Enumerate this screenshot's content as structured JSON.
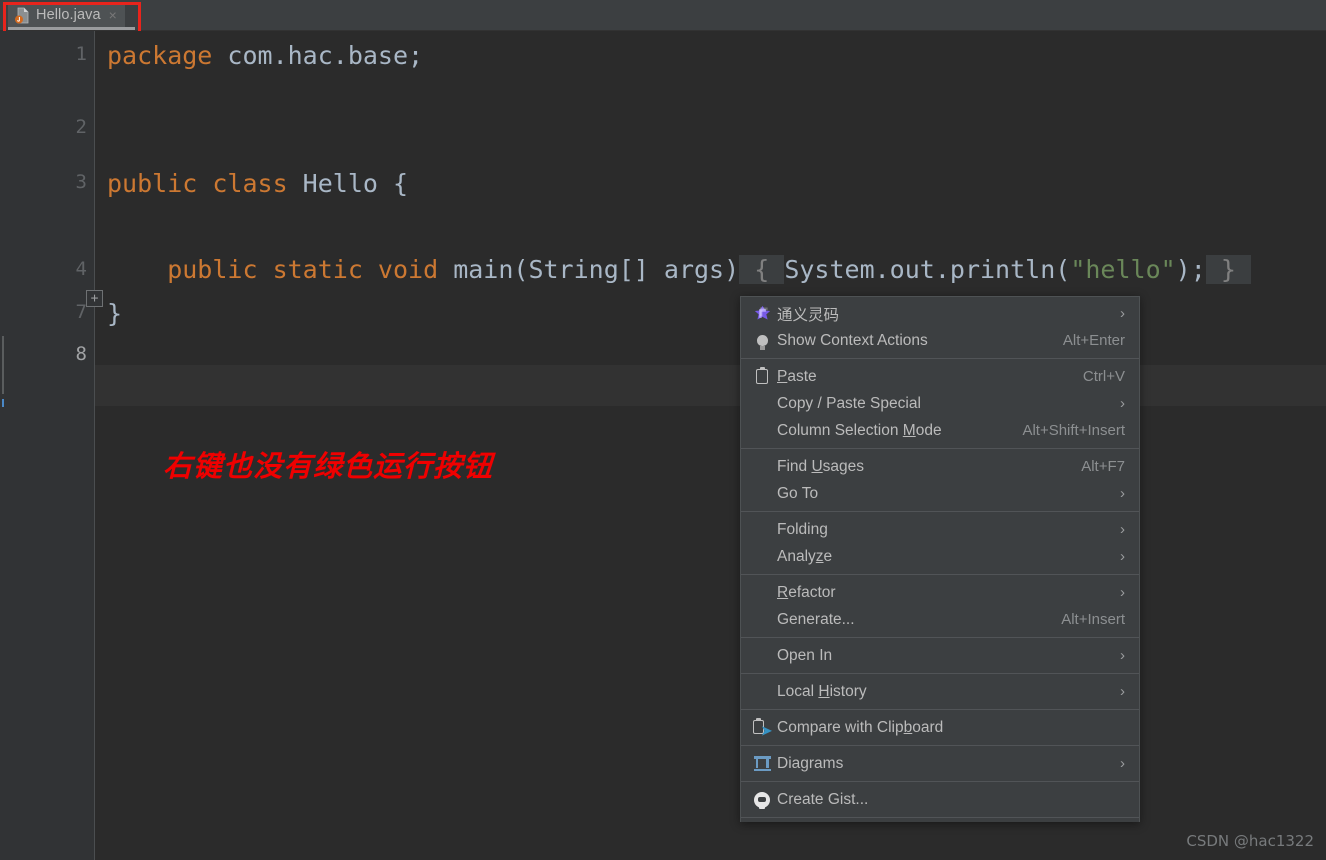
{
  "window": {
    "background": "#2b2b2b",
    "chrome_background": "#3c3f41"
  },
  "tab_bar": {
    "tabs": [
      {
        "label": "Hello.java",
        "icon": "java-file-icon",
        "close_glyph": "×",
        "active": true
      }
    ],
    "highlight_color": "#e8241c"
  },
  "editor": {
    "gutter": {
      "line_numbers": [
        "1",
        "2",
        "3",
        "4",
        "7",
        "8"
      ],
      "fold_marker": "+"
    },
    "lines": [
      {
        "num": "1",
        "segments": [
          {
            "text": "package",
            "cls": "kw"
          },
          {
            "text": " com.hac.base;",
            "cls": "ident"
          }
        ]
      },
      {
        "num": "3",
        "segments": [
          {
            "text": "public class ",
            "cls": "kw"
          },
          {
            "text": "Hello {",
            "cls": "ident"
          }
        ]
      },
      {
        "num": "4",
        "segments": [
          {
            "text": "    public static void ",
            "cls": "kw"
          },
          {
            "text": "main(String[] args)",
            "cls": "ident"
          },
          {
            "text": " { ",
            "cls": "fold-bg"
          },
          {
            "text": "System.out.println(",
            "cls": "ident"
          },
          {
            "text": "\"hello\"",
            "cls": "str"
          },
          {
            "text": ");",
            "cls": "ident"
          },
          {
            "text": " } ",
            "cls": "fold-bg"
          }
        ]
      },
      {
        "num": "7",
        "segments": [
          {
            "text": "}",
            "cls": "ident"
          }
        ]
      }
    ],
    "annotation": "右键也没有绿色运行按钮",
    "annotation_color": "#ef0000",
    "caret_line_number": "8"
  },
  "context_menu": {
    "groups": [
      {
        "items": [
          {
            "label": "通义灵码",
            "icon": "tongyi-lingma-icon",
            "accel": "",
            "submenu": true
          },
          {
            "label": "Show Context Actions",
            "icon": "lightbulb-icon",
            "accel": "Alt+Enter",
            "submenu": false
          }
        ]
      },
      {
        "items": [
          {
            "label": "Paste",
            "mnemonic": "P",
            "icon": "clipboard-icon",
            "accel": "Ctrl+V",
            "submenu": false
          },
          {
            "label": "Copy / Paste Special",
            "icon": "",
            "accel": "",
            "submenu": true
          },
          {
            "label": "Column Selection Mode",
            "mnemonic": "M",
            "icon": "",
            "accel": "Alt+Shift+Insert",
            "submenu": false
          }
        ]
      },
      {
        "items": [
          {
            "label": "Find Usages",
            "mnemonic": "U",
            "icon": "",
            "accel": "Alt+F7",
            "submenu": false
          },
          {
            "label": "Go To",
            "icon": "",
            "accel": "",
            "submenu": true
          }
        ]
      },
      {
        "items": [
          {
            "label": "Folding",
            "icon": "",
            "accel": "",
            "submenu": true
          },
          {
            "label": "Analyze",
            "mnemonic": "z",
            "icon": "",
            "accel": "",
            "submenu": true
          }
        ]
      },
      {
        "items": [
          {
            "label": "Refactor",
            "mnemonic": "R",
            "icon": "",
            "accel": "",
            "submenu": true
          },
          {
            "label": "Generate...",
            "icon": "",
            "accel": "Alt+Insert",
            "submenu": false
          }
        ]
      },
      {
        "items": [
          {
            "label": "Open In",
            "icon": "",
            "accel": "",
            "submenu": true
          }
        ]
      },
      {
        "items": [
          {
            "label": "Local History",
            "mnemonic": "H",
            "icon": "",
            "accel": "",
            "submenu": true
          }
        ]
      },
      {
        "items": [
          {
            "label": "Compare with Clipboard",
            "mnemonic": "b",
            "icon": "compare-clipboard-icon",
            "accel": "",
            "submenu": false
          }
        ]
      },
      {
        "items": [
          {
            "label": "Diagrams",
            "icon": "diagrams-icon",
            "accel": "",
            "submenu": true
          }
        ]
      },
      {
        "items": [
          {
            "label": "Create Gist...",
            "icon": "github-icon",
            "accel": "",
            "submenu": false
          }
        ]
      }
    ],
    "submenu_glyph": "›"
  },
  "watermark": "CSDN @hac1322"
}
